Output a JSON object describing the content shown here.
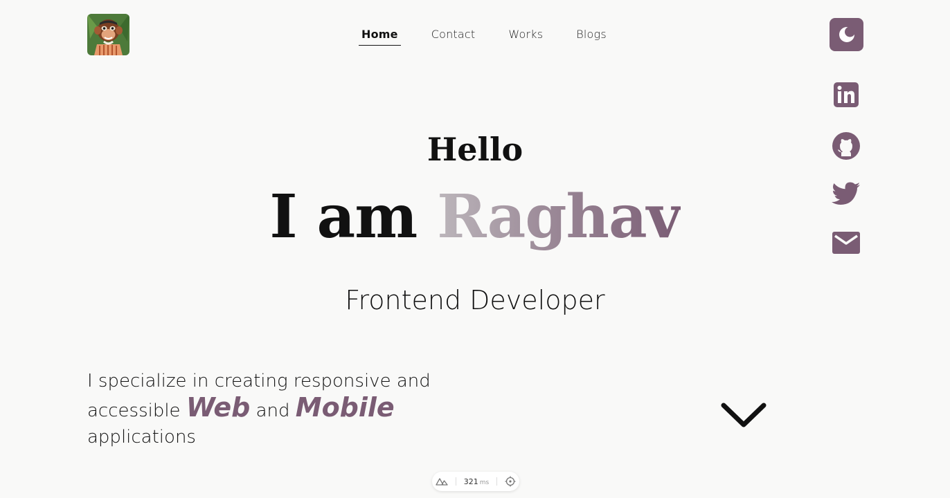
{
  "header": {
    "logo_icon": "monkey-avatar",
    "nav": [
      {
        "label": "Home",
        "active": true
      },
      {
        "label": "Contact",
        "active": false
      },
      {
        "label": "Works",
        "active": false
      },
      {
        "label": "Blogs",
        "active": false
      }
    ],
    "theme_toggle_icon": "moon-icon"
  },
  "socials": [
    "linkedin-icon",
    "github-icon",
    "twitter-icon",
    "mail-icon"
  ],
  "hero": {
    "greeting": "Hello",
    "intro_prefix": "I am ",
    "name": "Raghav",
    "role": "Frontend Developer"
  },
  "description": {
    "line1": "I specialize in creating responsive and",
    "accessible": "accessible",
    "web": "Web",
    "and": "and",
    "mobile": "Mobile",
    "applications": "applications"
  },
  "scroll_icon": "chevron-down-icon",
  "devtool": {
    "time_value": "321",
    "time_unit": "ms"
  },
  "colors": {
    "accent": "#7a5c74",
    "background": "#f9f9f8",
    "text": "#111111"
  }
}
